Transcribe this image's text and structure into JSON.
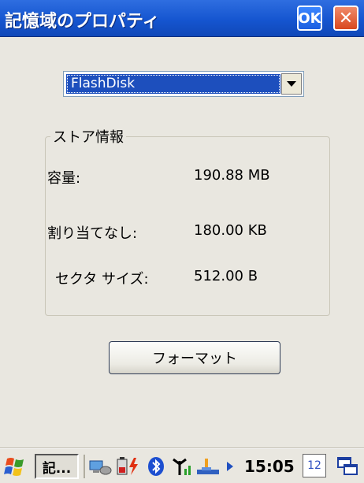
{
  "window": {
    "title": "記憶域のプロパティ",
    "ok_label": "OK",
    "close_label": "✕"
  },
  "storage_select": {
    "selected": "FlashDisk"
  },
  "store_info": {
    "legend": "ストア情報",
    "rows": [
      {
        "label": "容量:",
        "value": "190.88 MB"
      },
      {
        "label": "割り当てなし:",
        "value": "180.00 KB"
      },
      {
        "label": "セクタ サイズ:",
        "value": "512.00 B"
      }
    ]
  },
  "format_button": {
    "label": "フォーマット"
  },
  "taskbar": {
    "task_label": "記...",
    "time": "15:05",
    "input_label": "12"
  },
  "colors": {
    "titlebar": "#1555d0",
    "selection": "#1d4fbd",
    "close": "#d9481e"
  }
}
